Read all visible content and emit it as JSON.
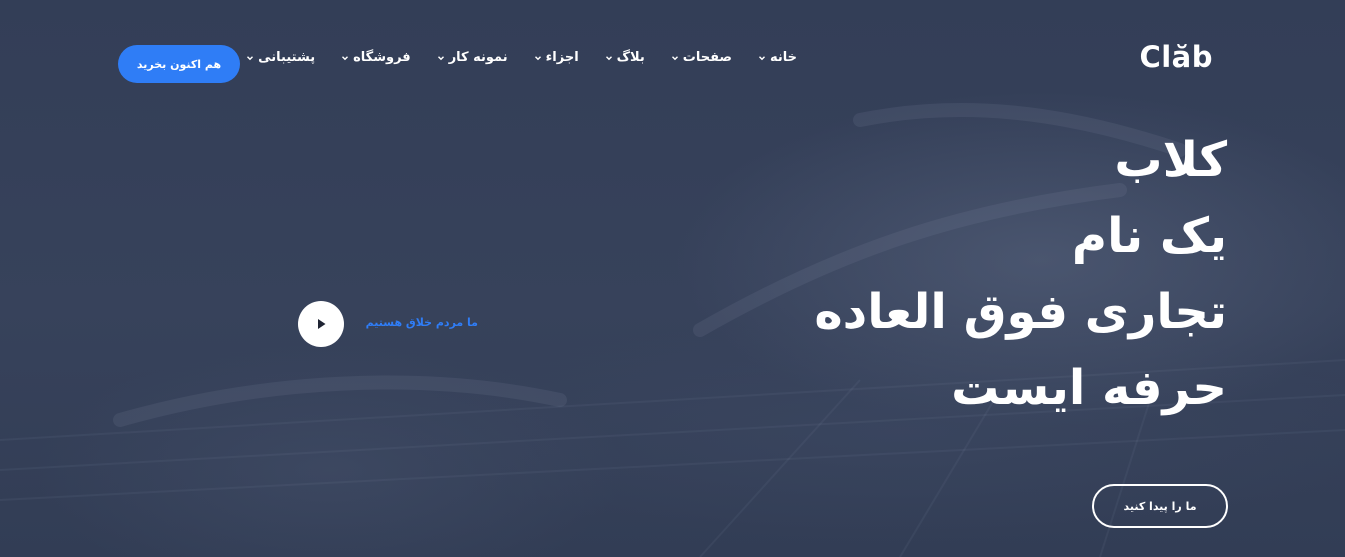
{
  "brand": {
    "logo_text": "Clăb"
  },
  "nav": {
    "items": [
      {
        "label": "خانه",
        "icon": "chevron-down-icon"
      },
      {
        "label": "صفحات",
        "icon": "chevron-down-icon"
      },
      {
        "label": "بلاگ",
        "icon": "chevron-down-icon"
      },
      {
        "label": "اجزاء",
        "icon": "chevron-down-icon"
      },
      {
        "label": "نمونه کار",
        "icon": "chevron-down-icon"
      },
      {
        "label": "فروشگاه",
        "icon": "chevron-down-icon"
      },
      {
        "label": "پشتیبانی",
        "icon": "chevron-down-icon"
      }
    ],
    "cta_label": "هم اکنون بخرید"
  },
  "hero": {
    "headline_lines": [
      "کلاب",
      "یک نام",
      "تجاری فوق العاده",
      "حرفه ایست"
    ],
    "video_caption": "ما مردم خلاق هستیم",
    "video_icon": "play-icon",
    "cta_label": "ما را پیدا کنید"
  },
  "colors": {
    "accent": "#2f7df6",
    "background": "#36415a",
    "text": "#ffffff"
  }
}
